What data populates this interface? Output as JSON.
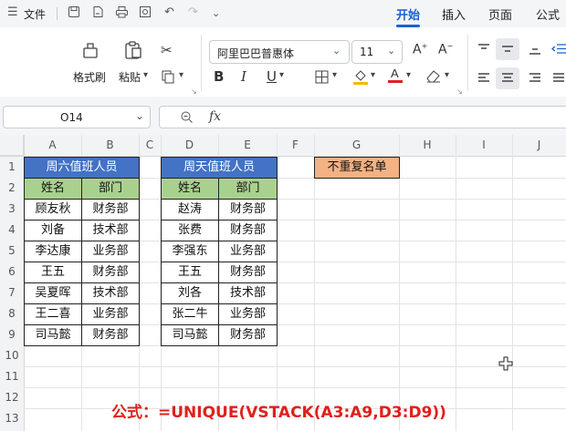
{
  "menubar": {
    "file_label": "文件",
    "tabs": [
      {
        "label": "开始",
        "active": true
      },
      {
        "label": "插入",
        "active": false
      },
      {
        "label": "页面",
        "active": false
      },
      {
        "label": "公式",
        "active": false
      }
    ]
  },
  "ribbon": {
    "format_painter_label": "格式刷",
    "paste_label": "粘贴",
    "font_name": "阿里巴巴普惠体",
    "font_size": "11"
  },
  "formula_bar": {
    "name_box": "O14",
    "fx_label": "fx",
    "formula": ""
  },
  "sheet": {
    "columns": [
      "A",
      "B",
      "C",
      "D",
      "E",
      "F",
      "G",
      "H",
      "I",
      "J"
    ],
    "rows": [
      "1",
      "2",
      "3",
      "4",
      "5",
      "6",
      "7",
      "8",
      "9",
      "10",
      "11",
      "12",
      "13"
    ],
    "table1": {
      "title": "周六值班人员",
      "headers": [
        "姓名",
        "部门"
      ],
      "rows": [
        [
          "顾友秋",
          "财务部"
        ],
        [
          "刘备",
          "技术部"
        ],
        [
          "李达康",
          "业务部"
        ],
        [
          "王五",
          "财务部"
        ],
        [
          "吴夏晖",
          "技术部"
        ],
        [
          "王二喜",
          "业务部"
        ],
        [
          "司马懿",
          "财务部"
        ]
      ]
    },
    "table2": {
      "title": "周天值班人员",
      "headers": [
        "姓名",
        "部门"
      ],
      "rows": [
        [
          "赵涛",
          "财务部"
        ],
        [
          "张费",
          "财务部"
        ],
        [
          "李强东",
          "业务部"
        ],
        [
          "王五",
          "财务部"
        ],
        [
          "刘各",
          "技术部"
        ],
        [
          "张二牛",
          "业务部"
        ],
        [
          "司马懿",
          "财务部"
        ]
      ]
    },
    "result_header": "不重复名单",
    "note": "公式：=UNIQUE(VSTACK(A3:A9,D3:D9))"
  },
  "colors": {
    "title_fill": "#4472c4",
    "header_fill": "#a9d18e",
    "result_fill": "#f4b183",
    "accent": "#1a5fd4",
    "note_color": "#e0201b"
  }
}
